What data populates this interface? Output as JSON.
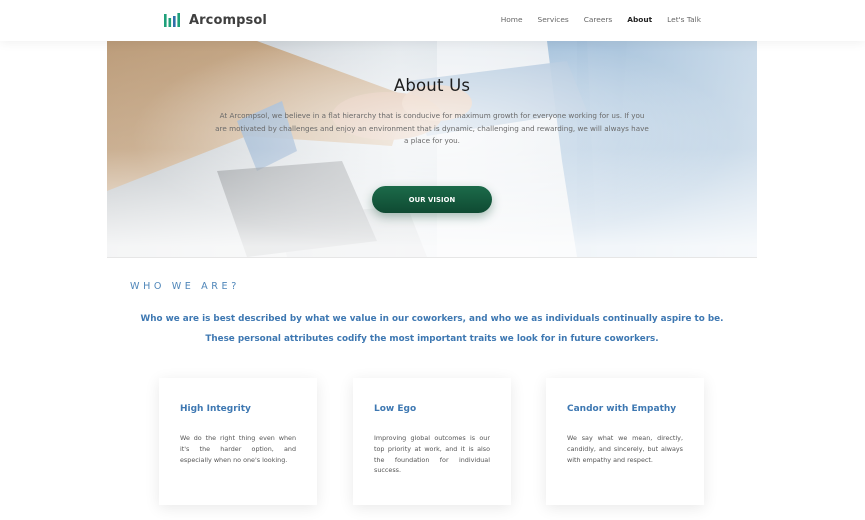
{
  "brand": {
    "name": "Arcompsol",
    "accent_color": "#1fa07a",
    "primary_blue": "#3e78b2",
    "button_color": "#1c6b4a"
  },
  "nav": {
    "items": [
      {
        "label": "Home",
        "active": false
      },
      {
        "label": "Services",
        "active": false
      },
      {
        "label": "Careers",
        "active": false
      },
      {
        "label": "About",
        "active": true
      },
      {
        "label": "Let's Talk",
        "active": false
      }
    ]
  },
  "hero": {
    "title": "About Us",
    "text": "At Arcompsol, we believe in a flat hierarchy that is conducive for maximum growth for everyone working for us. If you are motivated by challenges and enjoy an environment that is dynamic, challenging and rewarding, we will always have a place for you.",
    "button_label": "OUR VISION",
    "image": "handshake-photo"
  },
  "who": {
    "heading": "WHO WE ARE?",
    "line1": "Who we are is best described by what we value in our coworkers, and who we as individuals continually aspire to be.",
    "line2": "These personal attributes codify the most important traits we look for in future coworkers."
  },
  "cards": [
    {
      "title": "High Integrity",
      "text": "We do the right thing even when it's the harder option, and especially when no one's looking."
    },
    {
      "title": "Low Ego",
      "text": "Improving global outcomes is our top priority at work, and it is also the foundation for individual success."
    },
    {
      "title": "Candor with Empathy",
      "text": "We say what we mean, directly, candidly, and sincerely, but always with empathy and respect."
    }
  ]
}
